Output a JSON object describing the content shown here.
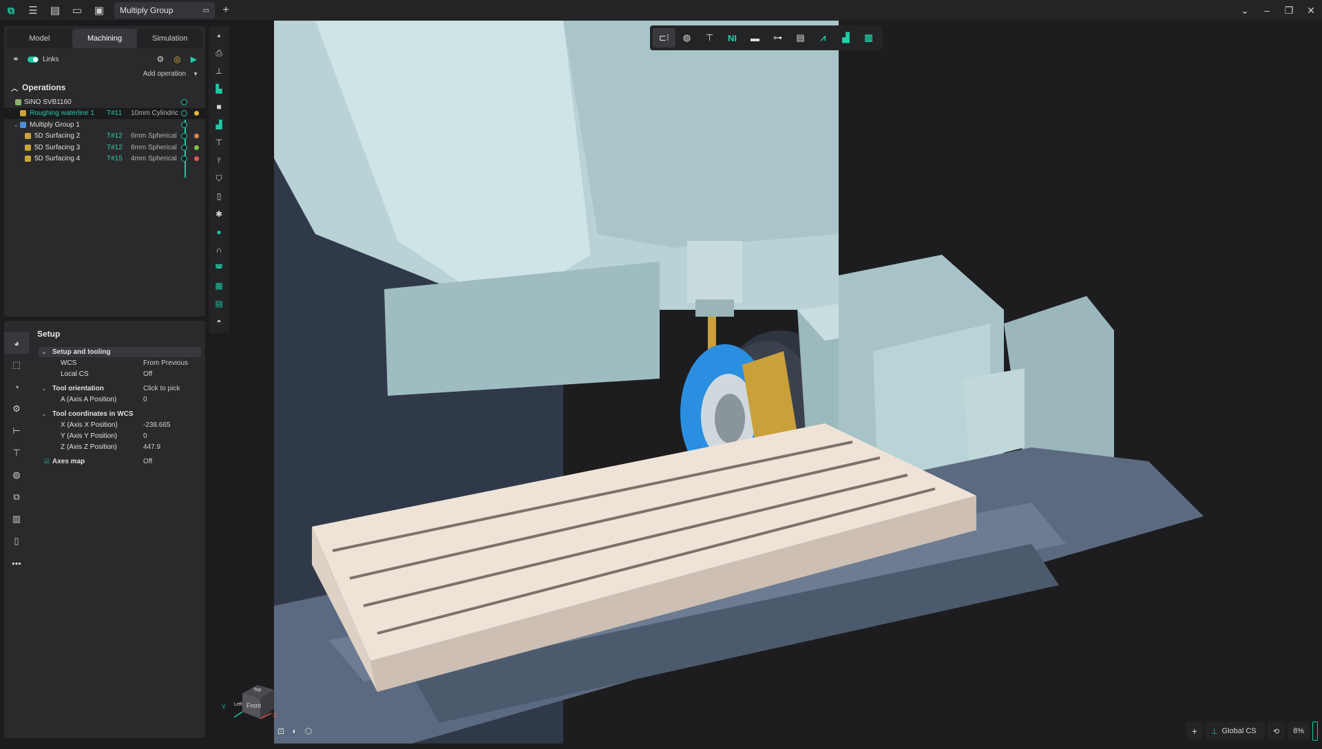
{
  "titlebar": {
    "document_tab": "Multiply Group",
    "icons": [
      "app-logo-icon",
      "menu-icon",
      "new-file-icon",
      "open-folder-icon",
      "save-icon"
    ]
  },
  "tabs": [
    "Model",
    "Machining",
    "Simulation"
  ],
  "links_label": "Links",
  "add_operation_label": "Add operation",
  "operations_title": "Operations",
  "operations": [
    {
      "name": "SINO SVB1160",
      "tool": "",
      "desc": "",
      "status_color": ""
    },
    {
      "name": "Roughing waterline 1",
      "tool": "T#11",
      "desc": "10mm Cylindric",
      "status_color": "#e6b53e"
    },
    {
      "name": "Multiply Group 1",
      "tool": "",
      "desc": "",
      "status_color": ""
    },
    {
      "name": "5D Surfacing 2",
      "tool": "T#12",
      "desc": "6mm Spherical",
      "status_color": "#d9844a"
    },
    {
      "name": "5D Surfacing 3",
      "tool": "T#12",
      "desc": "6mm Spherical",
      "status_color": "#7fc04a"
    },
    {
      "name": "5D Surfacing 4",
      "tool": "T#15",
      "desc": "4mm Spherical",
      "status_color": "#d9584f"
    }
  ],
  "setup": {
    "title": "Setup",
    "sections": [
      {
        "label": "Setup and tooling",
        "value": ""
      },
      {
        "label": "WCS",
        "value": "From Previous"
      },
      {
        "label": "Local CS",
        "value": "Off"
      },
      {
        "label": "Tool orientation",
        "value": "Click to pick"
      },
      {
        "label": "A (Axis A Position)",
        "value": "0"
      },
      {
        "label": "Tool coordinates in WCS",
        "value": ""
      },
      {
        "label": "X (Axis X Position)",
        "value": "-238.665"
      },
      {
        "label": "Y (Axis Y Position)",
        "value": "0"
      },
      {
        "label": "Z (Axis Z Position)",
        "value": "447.9"
      },
      {
        "label": "Axes map",
        "value": "Off"
      }
    ]
  },
  "viewcube": {
    "top": "Top",
    "front": "Front",
    "left": "Left",
    "axis_y": "Y",
    "axis_x": "X",
    "axis_z": "Z"
  },
  "status": {
    "cs_label": "Global CS",
    "percent": "8%"
  },
  "accent": "#1fc8a2"
}
